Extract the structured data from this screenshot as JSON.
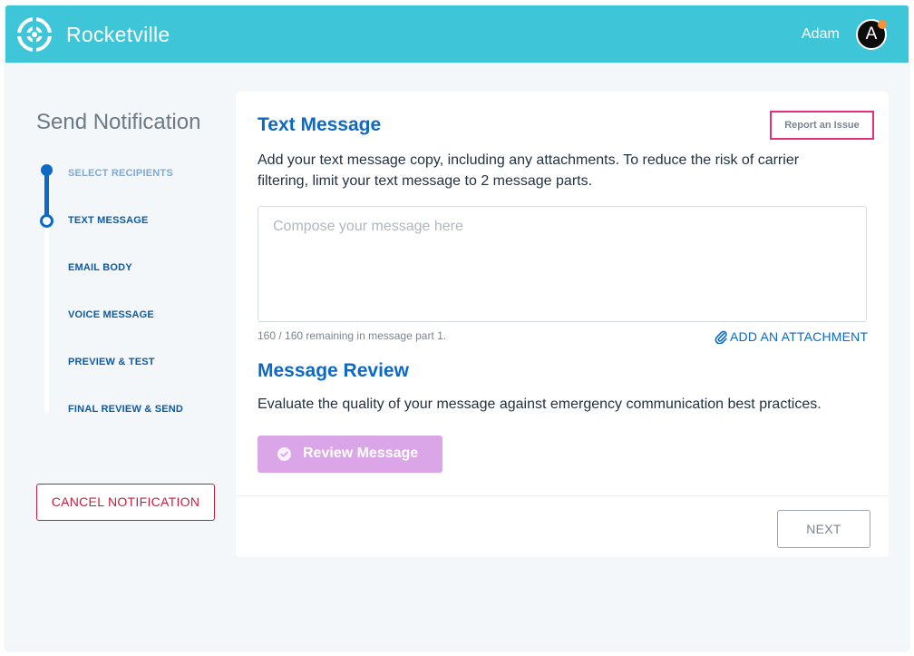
{
  "header": {
    "brand": "Rocketville",
    "user_name": "Adam",
    "avatar_initial": "A"
  },
  "sidebar": {
    "title": "Send Notification",
    "steps": [
      {
        "label": "SELECT RECIPIENTS",
        "state": "done"
      },
      {
        "label": "TEXT MESSAGE",
        "state": "current"
      },
      {
        "label": "EMAIL BODY",
        "state": "upcoming"
      },
      {
        "label": "VOICE MESSAGE",
        "state": "upcoming"
      },
      {
        "label": "PREVIEW & TEST",
        "state": "upcoming"
      },
      {
        "label": "FINAL REVIEW & SEND",
        "state": "upcoming"
      }
    ],
    "cancel_label": "CANCEL NOTIFICATION"
  },
  "main": {
    "title": "Text Message",
    "report_label": "Report an Issue",
    "description": "Add your text message copy, including any attachments. To reduce the risk of carrier filtering, limit your text message to 2 message parts.",
    "compose_placeholder": "Compose your message here",
    "compose_value": "",
    "counter_text": "160 / 160 remaining in message part 1.",
    "attach_label": "ADD AN ATTACHMENT",
    "review_title": "Message Review",
    "review_description": "Evaluate the quality of your message against emergency communication best practices.",
    "review_button_label": "Review Message",
    "next_label": "NEXT"
  },
  "colors": {
    "topbar": "#3ec6d8",
    "primary_blue": "#0d69c6",
    "cancel_red": "#c61e3d",
    "report_border": "#e12e7e",
    "review_button": "#dba6e7",
    "avatar_badge": "#f2933b"
  },
  "icons": {
    "logo": "rocketville-logo-icon",
    "attach": "paperclip-icon",
    "review": "check-circle-icon"
  }
}
